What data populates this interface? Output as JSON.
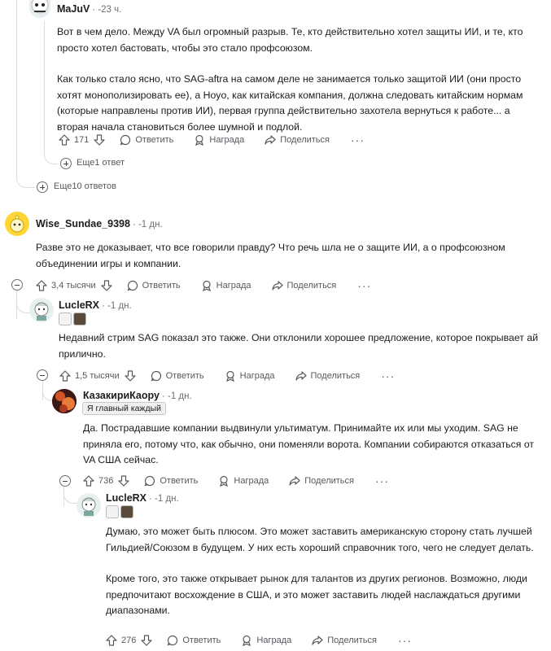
{
  "comments": [
    {
      "author": "MaJuV",
      "time": "-23 ч.",
      "paragraphs": [
        "Вот в чем дело. Между VA был огромный разрыв. Те, кто действительно хотел защиты ИИ, и те, кто просто хотел бастовать, чтобы это стало профсоюзом.",
        "Как только стало ясно, что SAG-aftra на самом деле не занимается только защитой ИИ (они просто хотят монополизировать ее), а Hoyo, как китайская компания, должна следовать китайским нормам (которые направлены против ИИ), первая группа действительно захотела вернуться к работе... а вторая начала становиться более шумной и подлой."
      ],
      "votes": "171",
      "reply": "Ответить",
      "award": "Награда",
      "share": "Поделиться"
    },
    {
      "author": "Wise_Sundae_9398",
      "time": "-1 дн.",
      "paragraphs": [
        "Разве это не доказывает, что все говорили правду? Что речь шла не о защите ИИ, а о профсоюзном объединении игры и компании."
      ],
      "votes": "3,4 тысячи",
      "reply": "Ответить",
      "award": "Награда",
      "share": "Поделиться"
    },
    {
      "author": "LucleRX",
      "time": "-1 дн.",
      "paragraphs": [
        "Недавний стрим SAG показал это также. Они отклонили хорошее предложение, которое покрывает ай прилично."
      ],
      "votes": "1,5 тысячи",
      "reply": "Ответить",
      "award": "Награда",
      "share": "Поделиться"
    },
    {
      "author": "КазакириКаору",
      "time": "-1 дн.",
      "flair": "Я главный каждый",
      "paragraphs": [
        "Да. Пострадавшие компании выдвинули ультиматум. Принимайте их или мы уходим. SAG не приняла его, потому что, как обычно, они поменяли ворота. Компании собираются отказаться от VA США сейчас."
      ],
      "votes": "736",
      "reply": "Ответить",
      "award": "Награда",
      "share": "Поделиться"
    },
    {
      "author": "LucleRX",
      "time": "-1 дн.",
      "paragraphs": [
        "Думаю, это может быть плюсом. Это может заставить американскую сторону стать лучшей Гильдией/Союзом в будущем. У них есть хороший справочник того, чего не следует делать.",
        "Кроме того, это также открывает рынок для талантов из других регионов. Возможно, люди предпочитают восхождение в США, и это может заставить людей наслаждаться другими диапазонами."
      ],
      "votes": "276",
      "reply": "Ответить",
      "award": "Награда",
      "share": "Поделиться"
    }
  ],
  "more_one": "Еще1 ответ",
  "more_ten": "Еще10 ответов",
  "colors": {
    "text": "#1c1c1c",
    "muted": "#55595d",
    "line": "#dcdcdc"
  },
  "icons": [
    "upvote-icon",
    "downvote-icon",
    "comment-icon",
    "award-icon",
    "share-icon",
    "more-icon",
    "collapse-icon",
    "expand-icon"
  ]
}
